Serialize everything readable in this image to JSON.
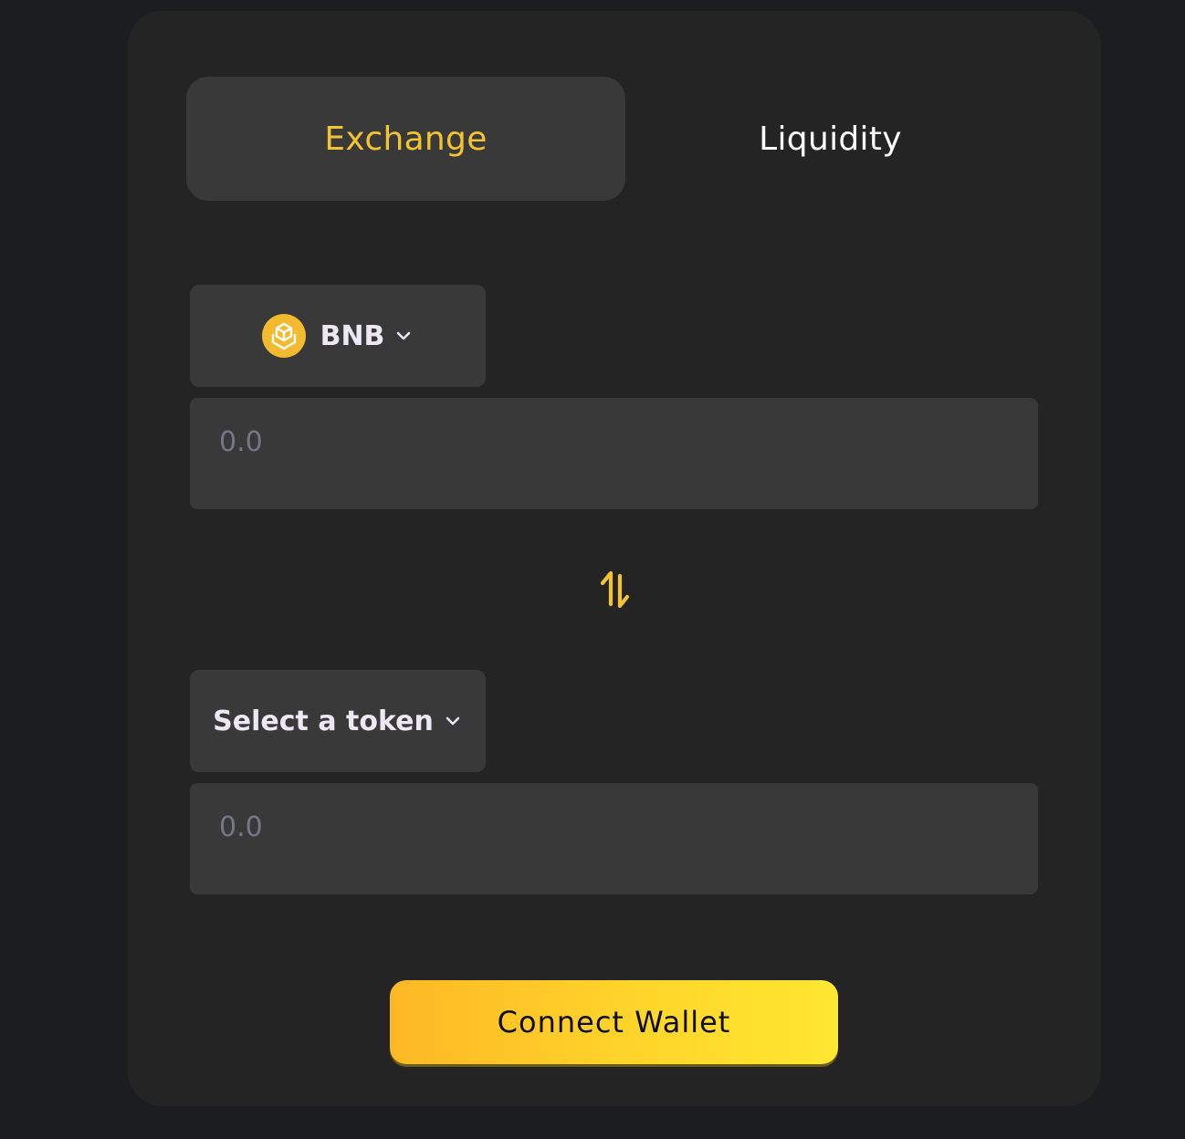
{
  "colors": {
    "page_background": "#1b1d20",
    "card_background": "#242424",
    "field_background": "#393939",
    "accent_yellow": "#f3c331",
    "button_gradient_start": "#fdb825",
    "button_gradient_end": "#fee732"
  },
  "tabs": [
    {
      "label": "Exchange",
      "active": true
    },
    {
      "label": "Liquidity",
      "active": false
    }
  ],
  "from": {
    "token": {
      "symbol": "BNB",
      "icon": "bnb-icon"
    },
    "amount": {
      "value": "",
      "placeholder": "0.0"
    }
  },
  "swap_icon": "swap-arrows-icon",
  "to": {
    "token": {
      "label": "Select a token"
    },
    "amount": {
      "value": "",
      "placeholder": "0.0"
    }
  },
  "connect_button": {
    "label": "Connect Wallet"
  }
}
